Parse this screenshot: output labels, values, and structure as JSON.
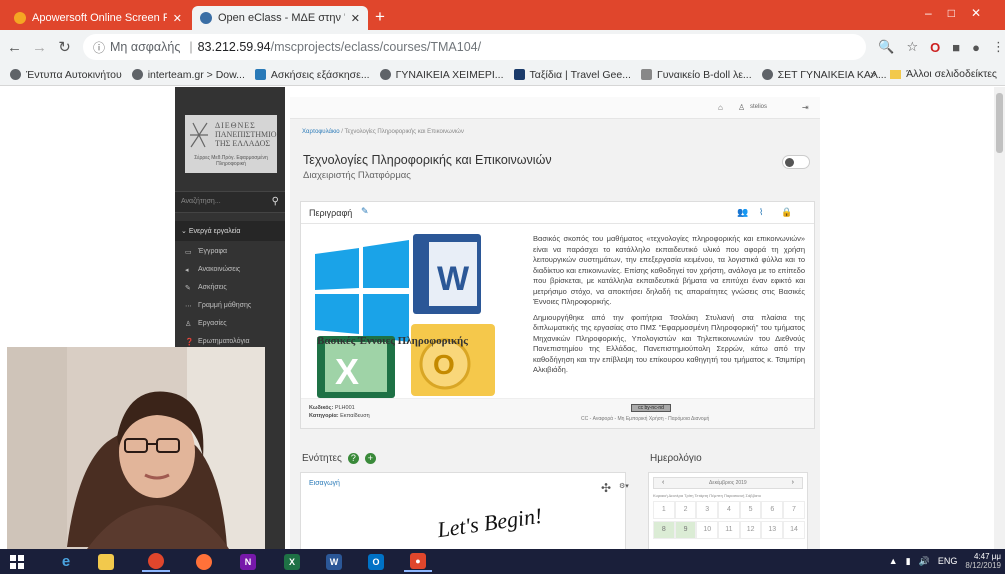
{
  "browser": {
    "tabs": [
      {
        "title": "Apowersoft Online Screen Recor",
        "active": false
      },
      {
        "title": "Open eClass - ΜΔΕ στην \"Εφαρμ",
        "active": true
      }
    ],
    "address": {
      "security_label": "Μη ασφαλής",
      "host": "83.212.59.94",
      "path": "/mscprojects/eclass/courses/TMA104/"
    },
    "bookmarks": [
      "Έντυπα Αυτοκινήτου",
      "interteam.gr > Dow...",
      "Ασκήσεις εξάσκησε...",
      "ΓΥΝΑΙΚΕΙΑ ΧΕΙΜΕΡΙ...",
      "Ταξίδια | Travel Gee...",
      "Γυναικείο B-doll λε...",
      "ΣΕΤ ΓΥΝΑΙΚΕΙΑ ΚΑΛ..."
    ],
    "other_bookmarks": "Άλλοι σελιδοδείκτες",
    "more_bookmarks": "»"
  },
  "sidebar": {
    "logo": {
      "line1": "ΔΙΕΘΝΕΣ",
      "line2": "ΠΑΝΕΠΙΣΤΗΜΙΟ",
      "line3": "ΤΗΣ ΕΛΛΑΔΟΣ",
      "sub": "Σέρρες\nΜεθ.Πρόγ. Εφαρμοσμένη Πληροφορική"
    },
    "search_placeholder": "Αναζήτηση...",
    "section_label": "Ενεργά εργαλεία",
    "items": [
      {
        "icon": "folder-icon",
        "label": "Έγγραφα"
      },
      {
        "icon": "megaphone-icon",
        "label": "Ανακοινώσεις"
      },
      {
        "icon": "pencil-icon",
        "label": "Ασκήσεις"
      },
      {
        "icon": "path-icon",
        "label": "Γραμμή μάθησης"
      },
      {
        "icon": "users-icon",
        "label": "Εργασίες"
      },
      {
        "icon": "question-icon",
        "label": "Ερωτηματολόγια"
      }
    ]
  },
  "page": {
    "breadcrumb": {
      "home": "Χαρτοφυλάκιο",
      "current": "Τεχνολογίες Πληροφορικής και Επικοινωνιών"
    },
    "topbar": {
      "user": "stelios"
    },
    "course_title": "Τεχνολογίες Πληροφορικής και Επικοινωνιών",
    "course_subtitle": "Διαχειριστής Πλατφόρμας",
    "description_title": "Περιγραφή",
    "collage_caption": "Βασικές Έννοιες Πληροφορικής",
    "description_paragraphs": [
      "Βασικός σκοπός του μαθήματος «τεχνολογίες πληροφορικής και επικοινωνιών» είναι να παράσχει το κατάλληλο εκπαιδευτικό υλικό που αφορά τη χρήση λειτουργικών συστημάτων, την επεξεργασία κειμένου, τα λογιστικά φύλλα και το διαδίκτυο και επικοινωνίες. Επίσης καθοδηγεί τον χρήστη, ανάλογα με το επίπεδο που βρίσκεται, με κατάλληλα εκπαιδευτικά βήματα να επιτύχει έναν εφικτό και μετρήσιμο στόχο, να αποκτήσει δηλαδή τις απαραίτητες γνώσεις στις Βασικές Έννοιες Πληροφορικής.",
      "Δημιουργήθηκε από την φοιτήτρια Τσολάκη Στυλιανή στα πλαίσια της διπλωματικής της εργασίας στο ΠΜΣ \"Εφαρμοσμένη Πληροφορική\" του τμήματος Μηχανικών Πληροφορικής, Υπολογιστών και Τηλεπικοινωνιών του Διεθνούς Πανεπιστημίου της Ελλάδας, Πανεπιστημιούπολη Σερρών, κάτω από την καθοδήγηση και την επίβλεψη του επίκουρου καθηγητή του τμήματος κ. Τσιμπίρη Αλκιβιάδη."
    ],
    "meta": {
      "code_label": "Κωδικός:",
      "code": "PLH001",
      "category_label": "Κατηγορία:",
      "category": "Εκπαίδευση"
    },
    "license": {
      "badge": "cc by-nc-nd",
      "text": "CC - Αναφορά - Μη Εμπορική Χρήση - Παρόμοια Διανομή"
    },
    "units_title": "Ενότητες",
    "units_intro": "Εισαγωγή",
    "lets_text": "Let's Begin!",
    "calendar": {
      "title": "Ημερολόγιο",
      "month": "Δεκέμβριος 2019",
      "days_header": "Κυριακή Δευτέρα Τρίτη Τετάρτη Πέμπτη Παρασκευή Σάββατο",
      "rows": [
        [
          "1",
          "2",
          "3",
          "4",
          "5",
          "6",
          "7"
        ],
        [
          "8",
          "9",
          "10",
          "11",
          "12",
          "13",
          "14"
        ]
      ]
    }
  },
  "taskbar": {
    "apps": [
      "ie-icon",
      "file-explorer-icon",
      "chrome-icon",
      "firefox-icon",
      "onenote-icon",
      "excel-icon",
      "word-icon",
      "outlook-icon",
      "recorder-icon"
    ],
    "language": "ENG",
    "time": "4:47 μμ",
    "date": "8/12/2019"
  },
  "colors": {
    "tabbar": "#e0462c",
    "sidebar": "#333333",
    "link": "#2a7ab8",
    "taskbar": "#1a1f3a"
  }
}
